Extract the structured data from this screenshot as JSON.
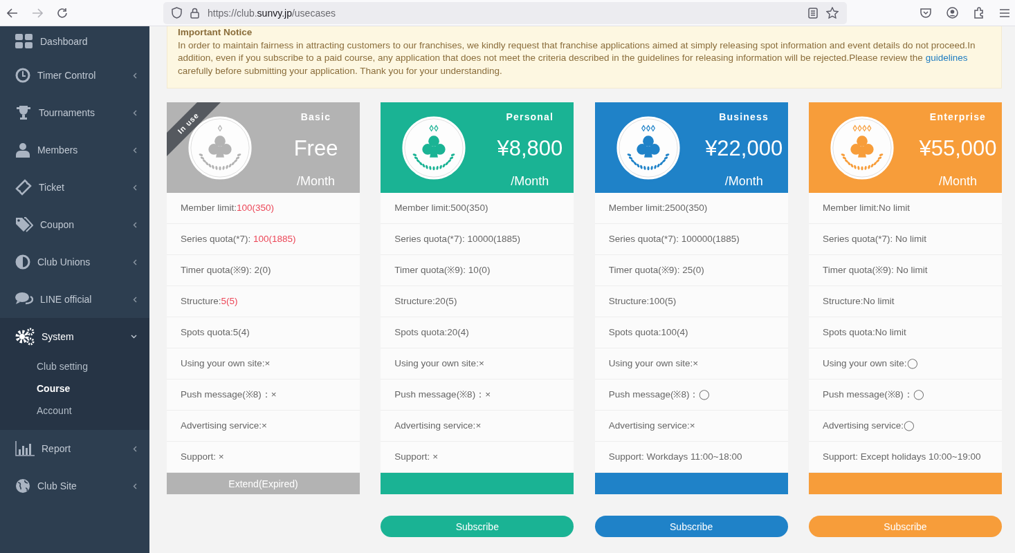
{
  "browser": {
    "url": {
      "scheme": "https://club.",
      "domain": "sunvy.jp",
      "path": "/usecases"
    },
    "forward_disabled": true
  },
  "sidebar": {
    "items": [
      {
        "label": "Dashboard",
        "kind": "link"
      },
      {
        "label": "Timer Control",
        "kind": "menu",
        "expanded": false
      },
      {
        "label": "Tournaments",
        "kind": "menu",
        "expanded": false
      },
      {
        "label": "Members",
        "kind": "menu",
        "expanded": false
      },
      {
        "label": "Ticket",
        "kind": "menu",
        "expanded": false
      },
      {
        "label": "Coupon",
        "kind": "menu",
        "expanded": false
      },
      {
        "label": "Club Unions",
        "kind": "menu",
        "expanded": false
      },
      {
        "label": "LINE official",
        "kind": "menu",
        "expanded": false
      },
      {
        "label": "System",
        "kind": "menu",
        "expanded": true,
        "children": [
          {
            "label": "Club setting",
            "selected": false
          },
          {
            "label": "Course",
            "selected": true
          },
          {
            "label": "Account",
            "selected": false
          }
        ]
      },
      {
        "label": "Report",
        "kind": "menu",
        "expanded": false
      },
      {
        "label": "Club Site",
        "kind": "menu",
        "expanded": false
      }
    ]
  },
  "notice": {
    "title": "Important Notice",
    "text_before": "In order to maintain fairness in attracting customers to our franchises, we kindly request that franchise applications aimed at simply releasing spot information and event details do not proceed.In addition, even if you subscribe to a paid course, any application that does not meet the criteria described in the guidelines for releasing information will be rejected.Please review the ",
    "link": "guidelines",
    "text_after": " carefully before submitting your application. Thank you for your understanding."
  },
  "plans": [
    {
      "name": "Basic",
      "price": "Free",
      "period": "/Month",
      "color": "#b3b3b3",
      "ribbon": "In use",
      "footer_label": "Extend(Expired)",
      "features": [
        {
          "label": "Member limit:",
          "value": "100(350)",
          "exceeded": true
        },
        {
          "label": "Series quota(*7): ",
          "value": "100(1885)",
          "exceeded": true
        },
        {
          "label": "Timer quota(※9): ",
          "value": "2(0)",
          "exceeded": false
        },
        {
          "label": "Structure:",
          "value": "5(5)",
          "exceeded": true
        },
        {
          "label": "Spots quota:",
          "value": "5(4)",
          "exceeded": false
        },
        {
          "label": "Using your own site:",
          "value": "×",
          "exceeded": false
        },
        {
          "label": "Push message(※8)：",
          "value": "×",
          "exceeded": false
        },
        {
          "label": "Advertising service:",
          "value": "×",
          "exceeded": false
        },
        {
          "label": "Support: ",
          "value": "×",
          "exceeded": false
        }
      ]
    },
    {
      "name": "Personal",
      "price": "¥8,800",
      "period": "/Month",
      "color": "#1ab394",
      "subscribe_label": "Subscribe",
      "features": [
        {
          "label": "Member limit:",
          "value": "500(350)",
          "exceeded": false
        },
        {
          "label": "Series quota(*7): ",
          "value": "10000(1885)",
          "exceeded": false
        },
        {
          "label": "Timer quota(※9): ",
          "value": "10(0)",
          "exceeded": false
        },
        {
          "label": "Structure:",
          "value": "20(5)",
          "exceeded": false
        },
        {
          "label": "Spots quota:",
          "value": "20(4)",
          "exceeded": false
        },
        {
          "label": "Using your own site:",
          "value": "×",
          "exceeded": false
        },
        {
          "label": "Push message(※8)：",
          "value": "×",
          "exceeded": false
        },
        {
          "label": "Advertising service:",
          "value": "×",
          "exceeded": false
        },
        {
          "label": "Support: ",
          "value": "×",
          "exceeded": false
        }
      ]
    },
    {
      "name": "Business",
      "price": "¥22,000",
      "period": "/Month",
      "color": "#1f82c8",
      "subscribe_label": "Subscribe",
      "features": [
        {
          "label": "Member limit:",
          "value": "2500(350)",
          "exceeded": false
        },
        {
          "label": "Series quota(*7): ",
          "value": "100000(1885)",
          "exceeded": false
        },
        {
          "label": "Timer quota(※9): ",
          "value": "25(0)",
          "exceeded": false
        },
        {
          "label": "Structure:",
          "value": "100(5)",
          "exceeded": false
        },
        {
          "label": "Spots quota:",
          "value": "100(4)",
          "exceeded": false
        },
        {
          "label": "Using your own site:",
          "value": "×",
          "exceeded": false
        },
        {
          "label": "Push message(※8)：",
          "value": "◯",
          "exceeded": false
        },
        {
          "label": "Advertising service:",
          "value": "×",
          "exceeded": false
        },
        {
          "label": "Support: ",
          "value": "Workdays 11:00~18:00",
          "exceeded": false
        }
      ]
    },
    {
      "name": "Enterprise",
      "price": "¥55,000",
      "period": "/Month",
      "color": "#f79d3a",
      "subscribe_label": "Subscribe",
      "features": [
        {
          "label": "Member limit:",
          "value": "No limit",
          "exceeded": false
        },
        {
          "label": "Series quota(*7): ",
          "value": "No limit",
          "exceeded": false
        },
        {
          "label": "Timer quota(※9): ",
          "value": "No limit",
          "exceeded": false
        },
        {
          "label": "Structure:",
          "value": "No limit",
          "exceeded": false
        },
        {
          "label": "Spots quota:",
          "value": "No limit",
          "exceeded": false
        },
        {
          "label": "Using your own site:",
          "value": "◯",
          "exceeded": false
        },
        {
          "label": "Push message(※8)：",
          "value": "◯",
          "exceeded": false
        },
        {
          "label": "Advertising service:",
          "value": "◯",
          "exceeded": false
        },
        {
          "label": "Support: ",
          "value": "Except holidays 10:00~19:00",
          "exceeded": false
        }
      ]
    }
  ]
}
